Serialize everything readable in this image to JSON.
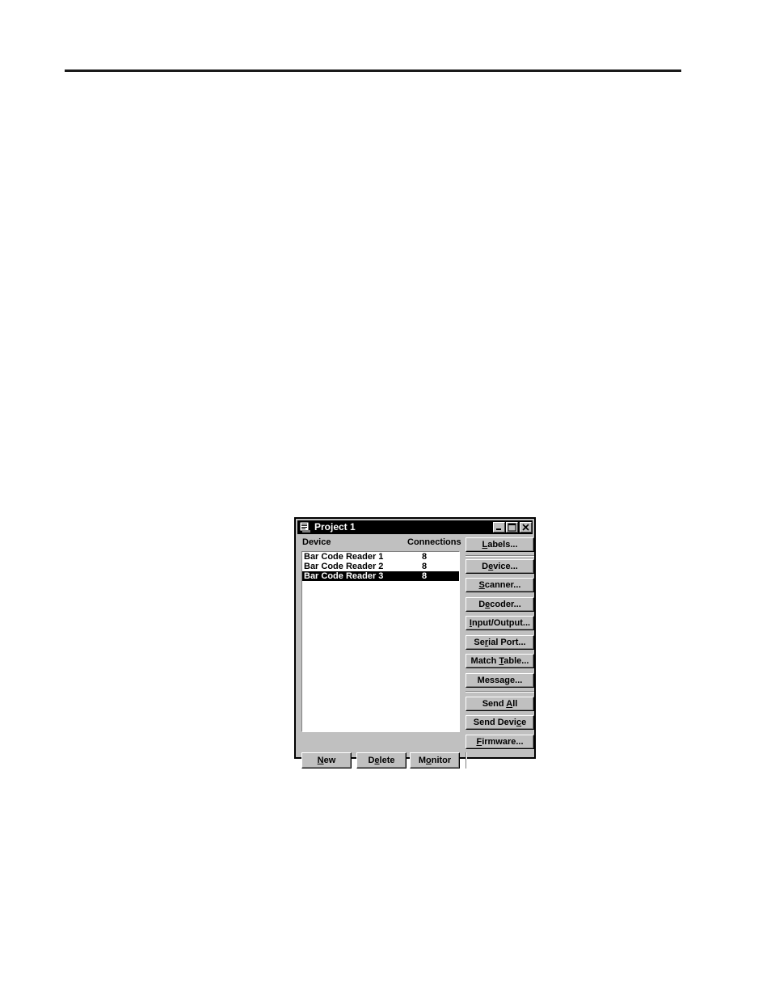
{
  "page": {
    "background": "#ffffff",
    "rule_color": "#1a1a1a"
  },
  "dialog": {
    "title": "Project 1",
    "title_icon": "project-document-icon",
    "colors": {
      "face": "#c0c0c0",
      "titlebar": "#000000",
      "titlebar_text": "#ffffff",
      "selection": "#000000",
      "selection_text": "#ffffff"
    },
    "window_controls": [
      {
        "name": "minimize-button",
        "glyph": "minimize-icon"
      },
      {
        "name": "maximize-button",
        "glyph": "maximize-icon"
      },
      {
        "name": "close-button",
        "glyph": "close-icon"
      }
    ],
    "list": {
      "headers": [
        "Device",
        "Connections"
      ],
      "rows": [
        {
          "device": "Bar Code Reader 1",
          "connections": "8",
          "selected": false
        },
        {
          "device": "Bar Code Reader 2",
          "connections": "8",
          "selected": false
        },
        {
          "device": "Bar Code Reader 3",
          "connections": "8",
          "selected": true
        }
      ]
    },
    "side_buttons": [
      {
        "label": "Labels...",
        "mnemonic": "L"
      },
      {
        "label": "Device...",
        "mnemonic": "e"
      },
      {
        "label": "Scanner...",
        "mnemonic": "S"
      },
      {
        "label": "Decoder...",
        "mnemonic": "e"
      },
      {
        "label": "Input/Output...",
        "mnemonic": "I"
      },
      {
        "label": "Serial Port...",
        "mnemonic": "r"
      },
      {
        "label": "Match Table...",
        "mnemonic": "T"
      },
      {
        "label": "Message...",
        "mnemonic": "g"
      },
      {
        "label": "Send All",
        "mnemonic": "A"
      },
      {
        "label": "Send Device",
        "mnemonic": "c"
      },
      {
        "label": "Firmware...",
        "mnemonic": "F"
      }
    ],
    "bottom_buttons": [
      {
        "label": "New",
        "mnemonic": "N"
      },
      {
        "label": "Delete",
        "mnemonic": "e"
      },
      {
        "label": "Monitor",
        "mnemonic": "o"
      }
    ]
  }
}
